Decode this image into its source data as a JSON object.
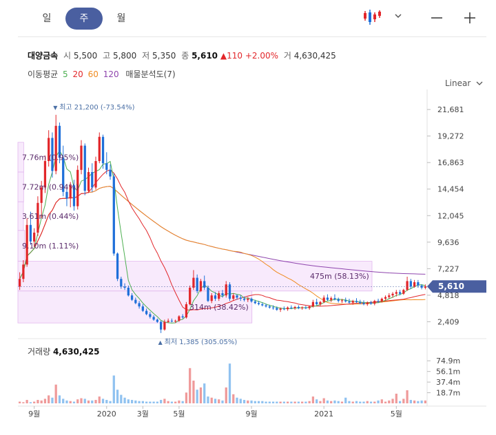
{
  "period_tabs": [
    {
      "label": "일",
      "active": false
    },
    {
      "label": "주",
      "active": true
    },
    {
      "label": "월",
      "active": false
    }
  ],
  "toolbar": {
    "chart_type_icon": "candlestick-icon",
    "dropdown_icon": "chevron-down-icon",
    "zoom_out_icon": "minus-icon",
    "zoom_in_icon": "plus-icon"
  },
  "stock": {
    "name": "대양금속",
    "open_label": "시",
    "open": "5,500",
    "high_label": "고",
    "high": "5,800",
    "low_label": "저",
    "low": "5,350",
    "close_label": "종",
    "close": "5,610",
    "change": "110",
    "change_pct": "+2.00%",
    "volume_label": "거",
    "volume": "4,630,425"
  },
  "ma": {
    "label": "이동평균",
    "periods": [
      "5",
      "20",
      "60",
      "120"
    ],
    "colors": [
      "#4caf50",
      "#e2262a",
      "#ef8a1e",
      "#8e44ad"
    ],
    "profile_label": "매물분석도(7)"
  },
  "scale_label": "Linear",
  "colors": {
    "up": "#e2262a",
    "down": "#1e6fd9",
    "badge": "#4a5fa0"
  },
  "chart_data": {
    "type": "candlestick",
    "y_ticks": [
      "21,681",
      "19,272",
      "16,863",
      "14,454",
      "12,045",
      "9,636",
      "7,227",
      "4,818",
      "2,409"
    ],
    "y_tick_values": [
      21681,
      19272,
      16863,
      14454,
      12045,
      9636,
      7227,
      4818,
      2409
    ],
    "ylim": [
      1000,
      23500
    ],
    "x_ticks": [
      "9월",
      "2020",
      "3월",
      "5월",
      "9월",
      "2021",
      "5월"
    ],
    "x_tick_positions": [
      4,
      24,
      34,
      44,
      64,
      84,
      104
    ],
    "current_price": "5,610",
    "current_price_value": 5610,
    "high_annotation": {
      "label": "최고",
      "value": "21,200 (-73.54%)",
      "index": 10
    },
    "low_annotation": {
      "label": "최저",
      "value": "1,385 (305.05%)",
      "index": 39
    },
    "volume_profile": [
      {
        "label": "7.76m (0.95%)",
        "lo": 16000,
        "hi": 18700,
        "pct": 0.95
      },
      {
        "label": "7.72m (0.94%)",
        "lo": 13300,
        "hi": 16000,
        "pct": 0.94
      },
      {
        "label": "3.61m (0.44%)",
        "lo": 10700,
        "hi": 13300,
        "pct": 0.44
      },
      {
        "label": "9.10m (1.11%)",
        "lo": 7900,
        "hi": 10700,
        "pct": 1.11
      },
      {
        "label": "475m (58.13%)",
        "lo": 5200,
        "hi": 7900,
        "pct": 58.13
      },
      {
        "label": "314m (38.42%)",
        "lo": 2300,
        "hi": 5200,
        "pct": 38.42
      }
    ],
    "candles": [
      [
        5600,
        6900,
        5300,
        6300
      ],
      [
        6300,
        8000,
        6000,
        7600
      ],
      [
        7600,
        11800,
        7400,
        11200
      ],
      [
        11200,
        12400,
        9400,
        9700
      ],
      [
        9700,
        10900,
        9200,
        10500
      ],
      [
        10500,
        13800,
        10200,
        13200
      ],
      [
        13200,
        15200,
        11800,
        14600
      ],
      [
        14600,
        17500,
        14100,
        17000
      ],
      [
        17000,
        19800,
        16500,
        19100
      ],
      [
        19100,
        19600,
        15500,
        16100
      ],
      [
        16100,
        21200,
        15800,
        20200
      ],
      [
        20200,
        20500,
        16800,
        17300
      ],
      [
        17300,
        18400,
        13800,
        14200
      ],
      [
        14200,
        14900,
        12900,
        13600
      ],
      [
        13600,
        15100,
        12800,
        14800
      ],
      [
        14800,
        15300,
        12500,
        12900
      ],
      [
        12900,
        16600,
        12600,
        16200
      ],
      [
        16200,
        18900,
        15800,
        18400
      ],
      [
        18400,
        18600,
        13900,
        14300
      ],
      [
        14300,
        16400,
        14100,
        16000
      ],
      [
        16000,
        16800,
        14200,
        14600
      ],
      [
        14600,
        17400,
        14400,
        17000
      ],
      [
        17000,
        19600,
        16800,
        19200
      ],
      [
        19200,
        19400,
        16300,
        16800
      ],
      [
        16800,
        17800,
        15800,
        16200
      ],
      [
        16200,
        16700,
        15300,
        15600
      ],
      [
        15600,
        15900,
        8400,
        8600
      ],
      [
        8600,
        8700,
        6100,
        6300
      ],
      [
        6300,
        6500,
        5400,
        5600
      ],
      [
        5600,
        5900,
        5300,
        5500
      ],
      [
        5500,
        5700,
        4700,
        4800
      ],
      [
        4800,
        5000,
        4300,
        4400
      ],
      [
        4400,
        4600,
        4000,
        4100
      ],
      [
        4100,
        4300,
        3600,
        3800
      ],
      [
        3800,
        4000,
        3300,
        3400
      ],
      [
        3400,
        3600,
        3000,
        3100
      ],
      [
        3100,
        3300,
        2700,
        2850
      ],
      [
        2850,
        3000,
        2500,
        2600
      ],
      [
        2600,
        2700,
        2300,
        2400
      ],
      [
        2400,
        2500,
        1385,
        1700
      ],
      [
        1700,
        2600,
        1600,
        2400
      ],
      [
        2400,
        2700,
        2300,
        2500
      ],
      [
        2500,
        2700,
        2350,
        2450
      ],
      [
        2450,
        2600,
        2300,
        2500
      ],
      [
        2500,
        3000,
        2400,
        2900
      ],
      [
        2900,
        3100,
        2700,
        2800
      ],
      [
        2800,
        4200,
        2700,
        4000
      ],
      [
        4000,
        5700,
        3900,
        5500
      ],
      [
        5500,
        7100,
        5300,
        6400
      ],
      [
        6400,
        6700,
        5000,
        5200
      ],
      [
        5200,
        6300,
        5100,
        6100
      ],
      [
        6100,
        6600,
        5300,
        5500
      ],
      [
        5500,
        5700,
        4200,
        4300
      ],
      [
        4300,
        5000,
        4100,
        4800
      ],
      [
        4800,
        5100,
        4300,
        4500
      ],
      [
        4500,
        5200,
        4300,
        5000
      ],
      [
        5000,
        5300,
        4600,
        4800
      ],
      [
        4800,
        6100,
        4600,
        5800
      ],
      [
        5800,
        6000,
        4300,
        4500
      ],
      [
        4500,
        5000,
        4300,
        4800
      ],
      [
        4800,
        4900,
        4400,
        4600
      ],
      [
        4600,
        4800,
        4300,
        4500
      ],
      [
        4500,
        4700,
        4250,
        4400
      ],
      [
        4400,
        4650,
        4200,
        4500
      ],
      [
        4500,
        4600,
        4150,
        4250
      ],
      [
        4250,
        4400,
        4000,
        4100
      ],
      [
        4100,
        4300,
        3900,
        4000
      ],
      [
        4000,
        4150,
        3800,
        3900
      ],
      [
        3900,
        4050,
        3700,
        3800
      ],
      [
        3800,
        3950,
        3600,
        3700
      ],
      [
        3700,
        3900,
        3500,
        3650
      ],
      [
        3650,
        3800,
        3400,
        3500
      ],
      [
        3500,
        3700,
        3300,
        3600
      ],
      [
        3600,
        3800,
        3450,
        3550
      ],
      [
        3550,
        3800,
        3400,
        3700
      ],
      [
        3700,
        3900,
        3550,
        3650
      ],
      [
        3650,
        3850,
        3500,
        3750
      ],
      [
        3750,
        3900,
        3550,
        3650
      ],
      [
        3650,
        3800,
        3500,
        3700
      ],
      [
        3700,
        3850,
        3550,
        3650
      ],
      [
        3650,
        3850,
        3500,
        3800
      ],
      [
        3800,
        4400,
        3700,
        4200
      ],
      [
        4200,
        4500,
        3900,
        4000
      ],
      [
        4000,
        4300,
        3850,
        4200
      ],
      [
        4200,
        4800,
        4100,
        4600
      ],
      [
        4600,
        4900,
        4300,
        4400
      ],
      [
        4400,
        4700,
        4200,
        4550
      ],
      [
        4550,
        4900,
        4350,
        4450
      ],
      [
        4450,
        4600,
        4150,
        4300
      ],
      [
        4300,
        4500,
        4100,
        4350
      ],
      [
        4350,
        4600,
        4150,
        4250
      ],
      [
        4250,
        4500,
        4050,
        4150
      ],
      [
        4150,
        4400,
        3950,
        4300
      ],
      [
        4300,
        4550,
        4100,
        4200
      ],
      [
        4200,
        4400,
        4000,
        4100
      ],
      [
        4100,
        4350,
        3900,
        4000
      ],
      [
        4000,
        4250,
        3850,
        4150
      ],
      [
        4150,
        4300,
        3950,
        4050
      ],
      [
        4050,
        4400,
        3900,
        4300
      ],
      [
        4300,
        4500,
        4100,
        4250
      ],
      [
        4250,
        4600,
        4150,
        4500
      ],
      [
        4500,
        4800,
        4350,
        4650
      ],
      [
        4650,
        5000,
        4500,
        4800
      ],
      [
        4800,
        5100,
        4600,
        4950
      ],
      [
        4950,
        5300,
        4700,
        5100
      ],
      [
        5100,
        5300,
        4800,
        4950
      ],
      [
        4950,
        5400,
        4850,
        5300
      ],
      [
        5300,
        6500,
        5200,
        6100
      ],
      [
        6100,
        6300,
        5400,
        5600
      ],
      [
        5600,
        6200,
        5500,
        6000
      ],
      [
        6000,
        6200,
        5500,
        5700
      ],
      [
        5700,
        5800,
        5350,
        5500
      ],
      [
        5500,
        5800,
        5350,
        5610
      ]
    ],
    "volume_label": "거래량",
    "volume_value": "4,630,425",
    "volume_ticks": [
      "74.9m",
      "56.1m",
      "37.4m",
      "18.7m"
    ],
    "volume_tick_values": [
      74.9,
      56.1,
      37.4,
      18.7
    ],
    "volume_max": 86,
    "volumes": [
      3,
      2,
      6,
      2,
      3,
      6,
      5,
      8,
      14,
      10,
      33,
      14,
      8,
      5,
      4,
      3,
      7,
      9,
      8,
      5,
      5,
      6,
      12,
      8,
      6,
      4,
      49,
      24,
      15,
      10,
      7,
      6,
      5,
      4,
      4,
      3,
      3,
      3,
      3,
      6,
      8,
      4,
      3,
      3,
      5,
      4,
      19,
      62,
      40,
      24,
      28,
      35,
      12,
      10,
      8,
      7,
      5,
      28,
      70,
      16,
      10,
      8,
      6,
      5,
      5,
      4,
      4,
      4,
      3,
      3,
      3,
      3,
      3,
      3,
      3,
      3,
      3,
      3,
      3,
      3,
      4,
      12,
      7,
      4,
      9,
      5,
      4,
      5,
      4,
      3,
      10,
      4,
      3,
      4,
      3,
      3,
      4,
      3,
      3,
      5,
      7,
      3,
      5,
      8,
      17,
      4,
      8,
      23,
      6,
      5,
      4,
      5,
      5
    ]
  }
}
